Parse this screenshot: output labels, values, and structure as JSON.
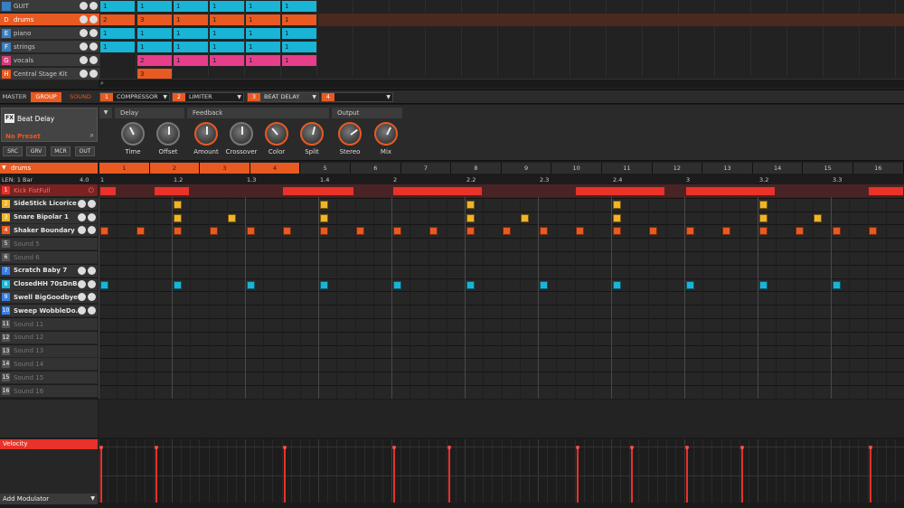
{
  "groups": [
    {
      "letter": "",
      "name": "GUIT",
      "color": "#3a7fbf",
      "selected": false
    },
    {
      "letter": "D",
      "name": "drums",
      "color": "#e85a22",
      "selected": true
    },
    {
      "letter": "E",
      "name": "piano",
      "color": "#3a7fbf",
      "selected": false
    },
    {
      "letter": "F",
      "name": "strings",
      "color": "#3a7fbf",
      "selected": false
    },
    {
      "letter": "G",
      "name": "vocals",
      "color": "#d63d7a",
      "selected": false
    },
    {
      "letter": "H",
      "name": "Central Stage Kit",
      "color": "#e85a22",
      "selected": false
    }
  ],
  "arrangement_rows": [
    {
      "color": "#19b4d6",
      "clips": [
        "1",
        "1",
        "1",
        "1",
        "1",
        "1"
      ],
      "start": 0
    },
    {
      "color": "#e85a22",
      "clips": [
        "2",
        "3",
        "1",
        "1",
        "1",
        "1"
      ],
      "start": 0
    },
    {
      "color": "#19b4d6",
      "clips": [
        "1",
        "1",
        "1",
        "1",
        "1",
        "1"
      ],
      "start": 0
    },
    {
      "color": "#19b4d6",
      "clips": [
        "1",
        "1",
        "1",
        "1",
        "1",
        "1"
      ],
      "start": 0
    },
    {
      "color": "#e63e8a",
      "clips": [
        "2",
        "1",
        "1",
        "1",
        "1"
      ],
      "start": 1
    },
    {
      "color": "#e85a22",
      "clips": [
        "3"
      ],
      "start": 1
    }
  ],
  "plugin_bar": {
    "tabs": [
      "MASTER",
      "GROUP",
      "SOUND"
    ],
    "slots": [
      {
        "num": "1",
        "name": "COMPRESSOR",
        "selected": false
      },
      {
        "num": "2",
        "name": "LIMITER",
        "selected": false
      },
      {
        "num": "3",
        "name": "BEAT DELAY",
        "selected": true
      },
      {
        "num": "4",
        "name": "",
        "selected": false
      }
    ]
  },
  "fx": {
    "icon_text": "FX",
    "name": "Beat Delay",
    "preset": "No Preset",
    "buttons": [
      "SRC",
      "GRV",
      "MCR",
      "OUT"
    ],
    "sections": [
      "Delay",
      "Feedback",
      "Output"
    ],
    "knobs": [
      {
        "label": "Time",
        "value": 0.4,
        "accent": false
      },
      {
        "label": "Offset",
        "value": 0.5,
        "accent": false
      },
      {
        "label": "Amount",
        "value": 0.5,
        "accent": true
      },
      {
        "label": "Crossover",
        "value": 0.5,
        "accent": false
      },
      {
        "label": "Color",
        "value": 0.35,
        "accent": true
      },
      {
        "label": "Split",
        "value": 0.55,
        "accent": true
      },
      {
        "label": "Stereo",
        "value": 0.7,
        "accent": true
      },
      {
        "label": "Mix",
        "value": 0.6,
        "accent": true
      }
    ]
  },
  "pattern": {
    "group_label": "drums",
    "length_label": "LEN: 1 Bar",
    "zoom_value": "4.0",
    "pattern_buttons": [
      "1",
      "2",
      "3",
      "4",
      "5",
      "6",
      "7",
      "8",
      "9",
      "10",
      "11",
      "12",
      "13",
      "14",
      "15",
      "16"
    ],
    "active_count": 4,
    "ruler": [
      "1",
      "1.2",
      "1.3",
      "1.4",
      "2",
      "2.2",
      "2.3",
      "2.4",
      "3",
      "3.2",
      "3.3"
    ]
  },
  "sounds": [
    {
      "num": "1",
      "name": "Kick FistFull",
      "color": "#e8322a",
      "on": true,
      "selected": true
    },
    {
      "num": "2",
      "name": "SideStick Licorice",
      "color": "#f0b428",
      "on": true,
      "selected": false
    },
    {
      "num": "3",
      "name": "Snare Bipolar 1",
      "color": "#f0b428",
      "on": true,
      "selected": false
    },
    {
      "num": "4",
      "name": "Shaker Boundary",
      "color": "#e85a22",
      "on": true,
      "selected": false
    },
    {
      "num": "5",
      "name": "Sound 5",
      "color": "#555555",
      "on": false,
      "selected": false
    },
    {
      "num": "6",
      "name": "Sound 6",
      "color": "#555555",
      "on": false,
      "selected": false
    },
    {
      "num": "7",
      "name": "Scratch Baby 7",
      "color": "#3a7fe8",
      "on": true,
      "selected": false
    },
    {
      "num": "8",
      "name": "ClosedHH 70sDnB",
      "color": "#19b4d6",
      "on": true,
      "selected": false
    },
    {
      "num": "9",
      "name": "Swell BigGoodbye",
      "color": "#3a7fe8",
      "on": true,
      "selected": false
    },
    {
      "num": "10",
      "name": "Sweep WobbleDo...",
      "color": "#3a7fe8",
      "on": true,
      "selected": false
    },
    {
      "num": "11",
      "name": "Sound 11",
      "color": "#555555",
      "on": false,
      "selected": false
    },
    {
      "num": "12",
      "name": "Sound 12",
      "color": "#555555",
      "on": false,
      "selected": false
    },
    {
      "num": "13",
      "name": "Sound 13",
      "color": "#555555",
      "on": false,
      "selected": false
    },
    {
      "num": "14",
      "name": "Sound 14",
      "color": "#555555",
      "on": false,
      "selected": false
    },
    {
      "num": "15",
      "name": "Sound 15",
      "color": "#555555",
      "on": false,
      "selected": false
    },
    {
      "num": "16",
      "name": "Sound 16",
      "color": "#555555",
      "on": false,
      "selected": false
    }
  ],
  "steps": {
    "total": 44,
    "rows": [
      {
        "row": 0,
        "color": "#e8322a",
        "notes": [
          [
            0,
            1
          ],
          [
            3,
            2
          ],
          [
            10,
            4
          ],
          [
            16,
            4
          ],
          [
            19,
            2
          ],
          [
            26,
            4
          ],
          [
            29,
            2
          ],
          [
            32,
            4
          ],
          [
            35,
            2
          ],
          [
            42,
            2
          ]
        ]
      },
      {
        "row": 1,
        "color": "#f0b428",
        "notes": [
          [
            4,
            1
          ],
          [
            12,
            1
          ],
          [
            20,
            1
          ],
          [
            28,
            1
          ],
          [
            36,
            1
          ]
        ]
      },
      {
        "row": 2,
        "color": "#f0b428",
        "notes": [
          [
            4,
            1
          ],
          [
            7,
            1
          ],
          [
            12,
            1
          ],
          [
            20,
            1
          ],
          [
            23,
            1
          ],
          [
            28,
            1
          ],
          [
            36,
            1
          ],
          [
            39,
            1
          ]
        ]
      },
      {
        "row": 3,
        "color": "#e85a22",
        "notes": [
          [
            0,
            1
          ],
          [
            2,
            1
          ],
          [
            4,
            1
          ],
          [
            6,
            1
          ],
          [
            8,
            1
          ],
          [
            10,
            1
          ],
          [
            12,
            1
          ],
          [
            14,
            1
          ],
          [
            16,
            1
          ],
          [
            18,
            1
          ],
          [
            20,
            1
          ],
          [
            22,
            1
          ],
          [
            24,
            1
          ],
          [
            26,
            1
          ],
          [
            28,
            1
          ],
          [
            30,
            1
          ],
          [
            32,
            1
          ],
          [
            34,
            1
          ],
          [
            36,
            1
          ],
          [
            38,
            1
          ],
          [
            40,
            1
          ],
          [
            42,
            1
          ]
        ]
      },
      {
        "row": 7,
        "color": "#19b4d6",
        "notes": [
          [
            0,
            1
          ],
          [
            4,
            1
          ],
          [
            8,
            1
          ],
          [
            12,
            1
          ],
          [
            16,
            1
          ],
          [
            20,
            1
          ],
          [
            24,
            1
          ],
          [
            28,
            1
          ],
          [
            32,
            1
          ],
          [
            36,
            1
          ],
          [
            40,
            1
          ]
        ]
      }
    ]
  },
  "velocity": {
    "label": "Velocity",
    "steps": [
      0,
      3,
      10,
      16,
      19,
      26,
      29,
      32,
      35,
      42
    ],
    "value": 1.0
  },
  "add_modulator": "Add Modulator",
  "colors": {
    "accent": "#e85a22",
    "kick": "#e8322a"
  }
}
